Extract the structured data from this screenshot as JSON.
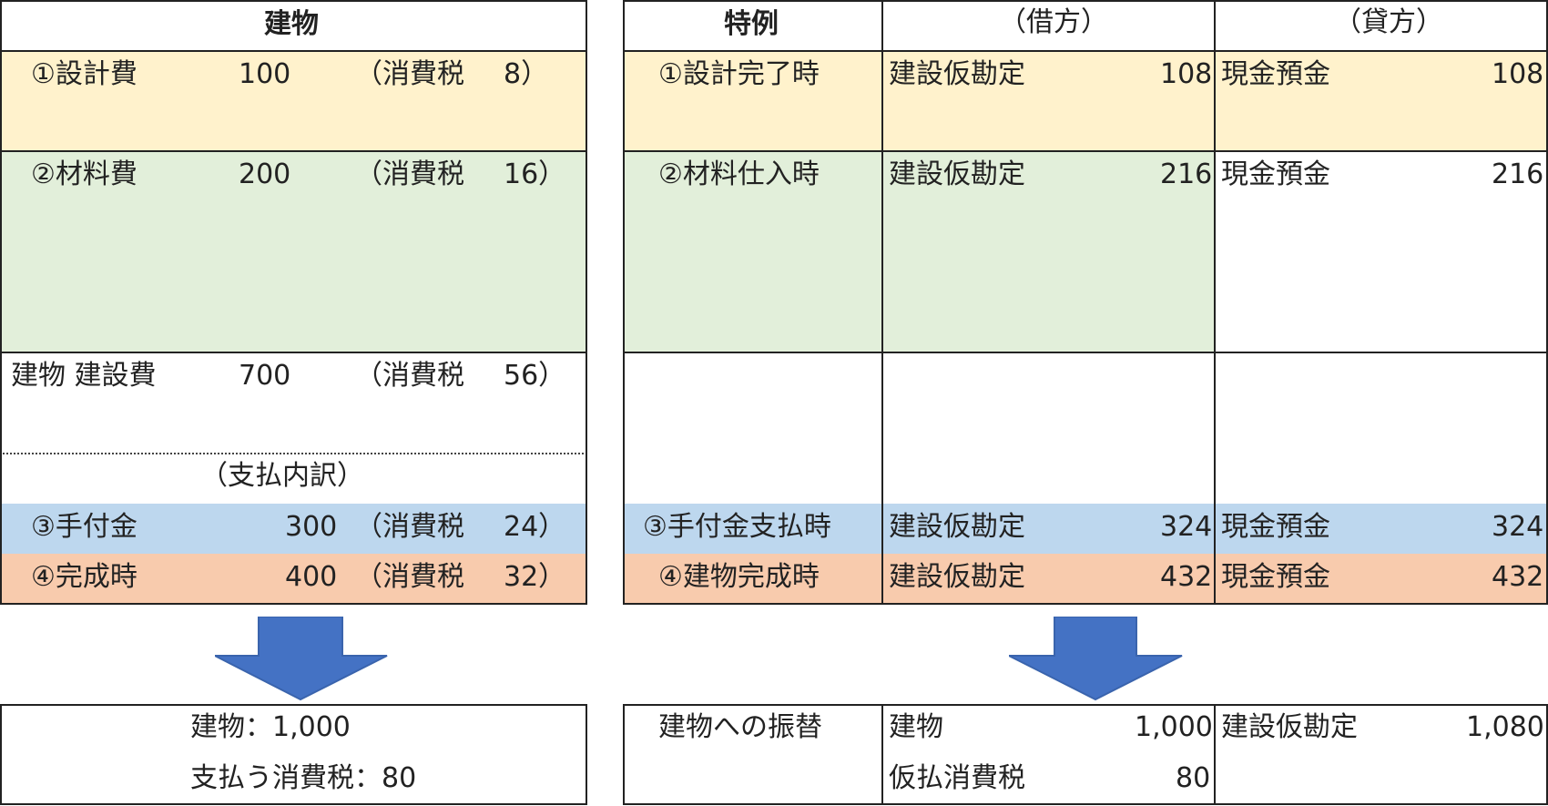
{
  "left": {
    "header": "建物",
    "rows": [
      {
        "label": "①設計費",
        "amount": "100",
        "tax_label": "（消費税",
        "tax": "8）"
      },
      {
        "label": "②材料費",
        "amount": "200",
        "tax_label": "（消費税",
        "tax": "16）"
      },
      {
        "label": "建物 建設費",
        "amount": "700",
        "tax_label": "（消費税",
        "tax": "56）"
      }
    ],
    "breakdown_title": "（支払内訳）",
    "payments": [
      {
        "label": "③手付金",
        "amount": "300",
        "tax_label": "（消費税",
        "tax": "24）"
      },
      {
        "label": "④完成時",
        "amount": "400",
        "tax_label": "（消費税",
        "tax": "32）"
      }
    ],
    "summary": {
      "line1": "建物：1,000",
      "line2": "支払う消費税：80"
    }
  },
  "right": {
    "headers": {
      "case": "特例",
      "debit": "（借方）",
      "credit": "（貸方）"
    },
    "rows": [
      {
        "case": "①設計完了時",
        "debit": "建設仮勘定",
        "debit_amount": "108",
        "credit": "現金預金",
        "credit_amount": "108"
      },
      {
        "case": "②材料仕入時",
        "debit": "建設仮勘定",
        "debit_amount": "216",
        "credit": "現金預金",
        "credit_amount": "216"
      },
      {
        "case": "③手付金支払時",
        "debit": "建設仮勘定",
        "debit_amount": "324",
        "credit": "現金預金",
        "credit_amount": "324"
      },
      {
        "case": "④建物完成時",
        "debit": "建設仮勘定",
        "debit_amount": "432",
        "credit": "現金預金",
        "credit_amount": "432"
      }
    ],
    "transfer": {
      "case": "建物への振替",
      "debit1": "建物",
      "debit1_amount": "1,000",
      "debit2": "仮払消費税",
      "debit2_amount": "80",
      "credit": "建設仮勘定",
      "credit_amount": "1,080"
    }
  },
  "colors": {
    "yellow": "#fff2cc",
    "green": "#e2efda",
    "blue": "#bdd7ee",
    "orange": "#f8cbad",
    "arrow": "#4472c4"
  }
}
